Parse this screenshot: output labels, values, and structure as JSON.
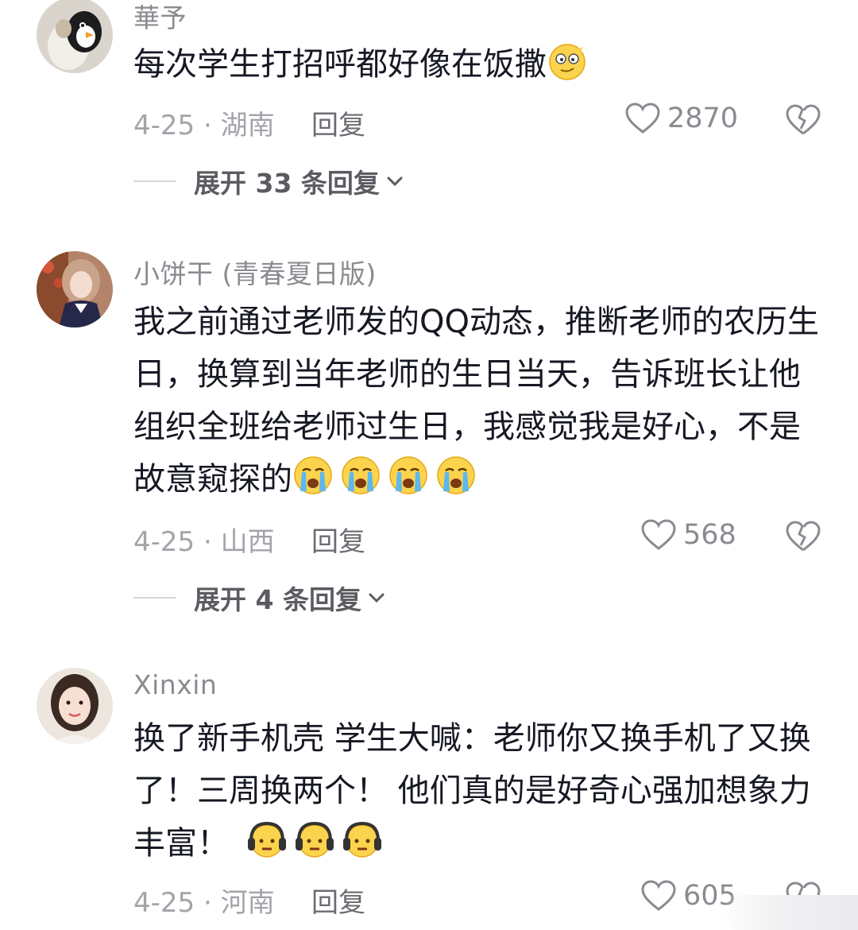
{
  "comments": [
    {
      "username": "華予",
      "text": "每次学生打招呼都好像在饭撒",
      "emojis": [
        "dizzy-face"
      ],
      "date_location": "4-25 · 湖南",
      "reply_label": "回复",
      "likes": "2870",
      "expand_label": "展开 33 条回复"
    },
    {
      "username": "小饼干 (青春夏日版)",
      "text": "我之前通过老师发的QQ动态，推断老师的农历生日，换算到当年老师的生日当天，告诉班长让他组织全班给老师过生日，我感觉我是好心，不是故意窥探的",
      "emojis": [
        "crying-face",
        "crying-face",
        "crying-face",
        "crying-face"
      ],
      "date_location": "4-25 · 山西",
      "reply_label": "回复",
      "likes": "568",
      "expand_label": "展开 4 条回复"
    },
    {
      "username": "Xinxin",
      "text": "换了新手机壳 学生大喊：老师你又换手机了又换了！三周换两个！ 他们真的是好奇心强加想象力丰富！",
      "emojis": [
        "headphone-face",
        "headphone-face",
        "headphone-face"
      ],
      "date_location": "4-25 · 河南",
      "reply_label": "回复",
      "likes": "605"
    }
  ],
  "colors": {
    "text": "#161823",
    "muted": "#a3a4aa",
    "username": "#8a8b91"
  }
}
